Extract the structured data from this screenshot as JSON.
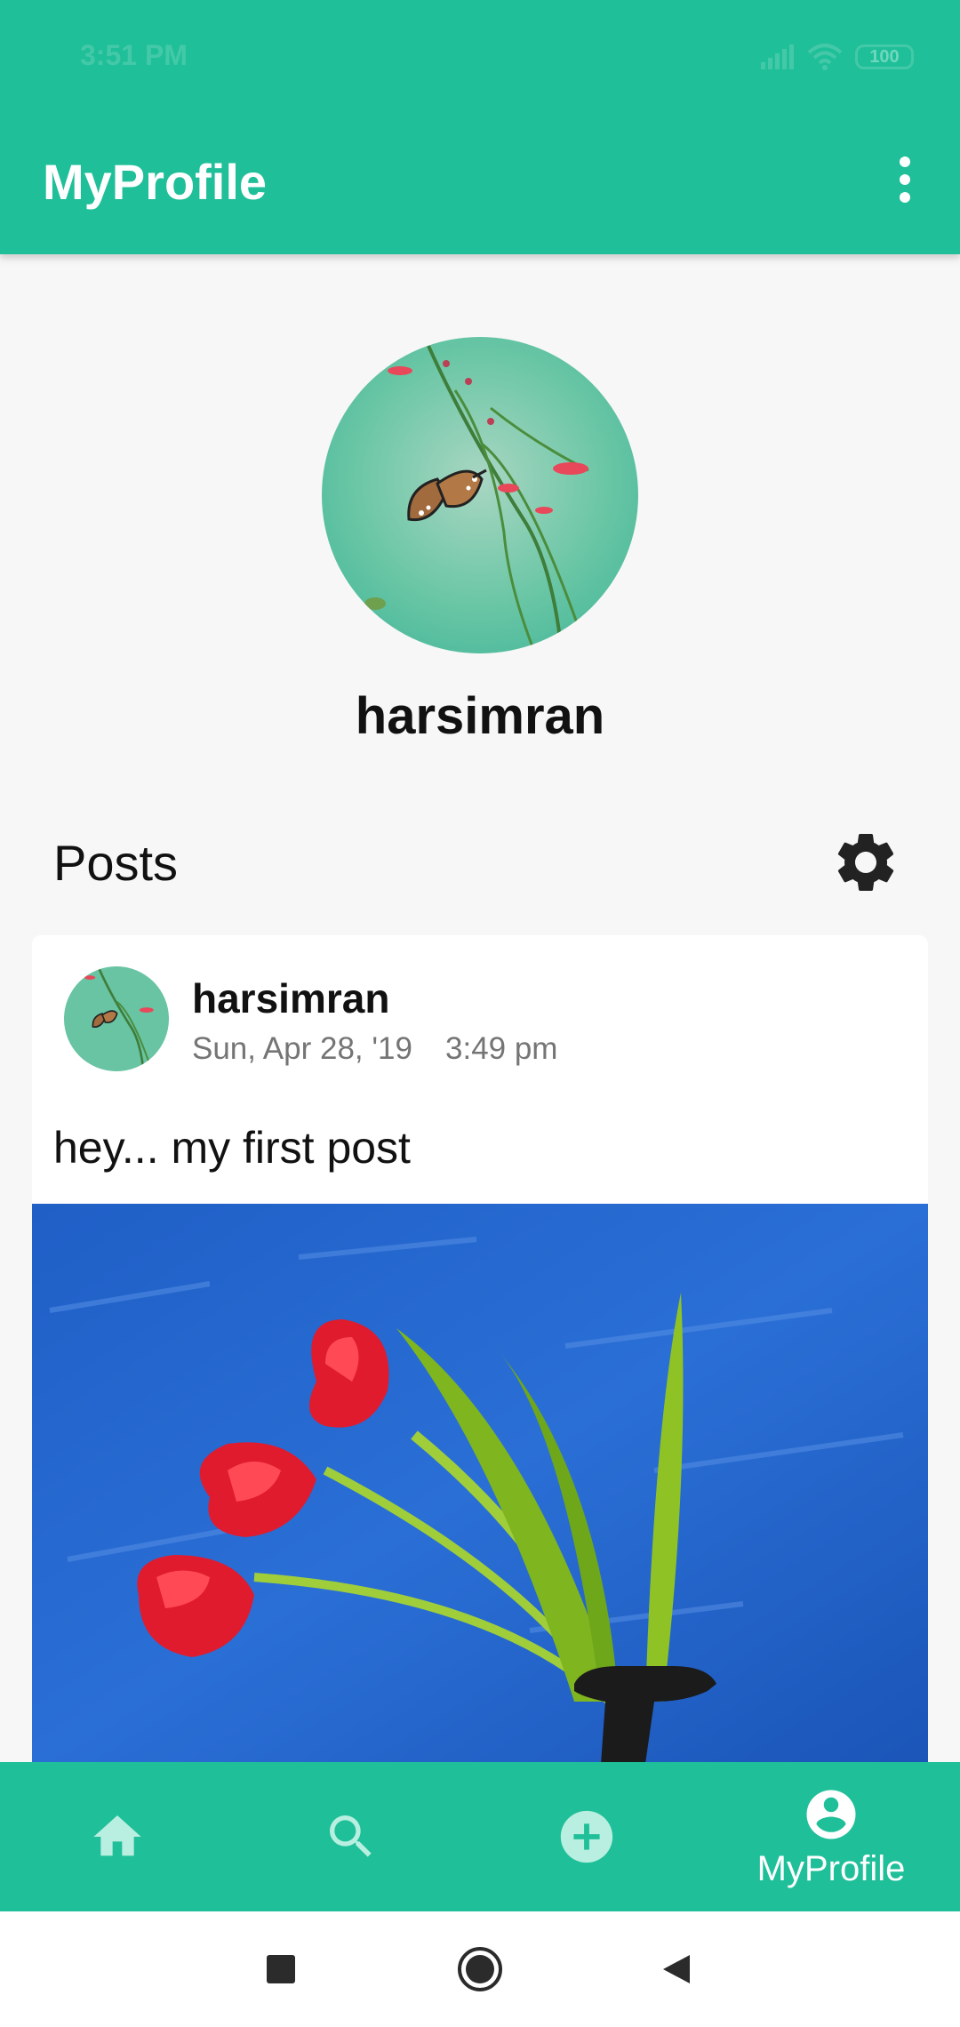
{
  "status_bar": {
    "time": "3:51 PM",
    "battery": "100",
    "icons": [
      "signal-icon",
      "wifi-icon",
      "battery-icon"
    ]
  },
  "app_bar": {
    "title": "MyProfile",
    "menu_icon": "more-vert-icon"
  },
  "profile": {
    "username": "harsimran",
    "avatar": "butterfly-photo"
  },
  "posts_section": {
    "heading": "Posts",
    "settings_icon": "gear-icon"
  },
  "post": {
    "author": "harsimran",
    "date": "Sun, Apr 28, '19",
    "time": "3:49 pm",
    "text": "hey... my first post",
    "image": "tulips-photo"
  },
  "bottom_nav": {
    "items": [
      {
        "icon": "home-icon",
        "label": ""
      },
      {
        "icon": "search-icon",
        "label": ""
      },
      {
        "icon": "add-circle-icon",
        "label": ""
      },
      {
        "icon": "account-circle-icon",
        "label": "MyProfile",
        "active": true
      }
    ]
  },
  "system_nav": {
    "icons": [
      "recent-apps-icon",
      "home-circle-icon",
      "back-triangle-icon"
    ]
  },
  "colors": {
    "primary": "#1fbf99",
    "nav_inactive": "#b8efe0",
    "background": "#f7f7f7"
  }
}
